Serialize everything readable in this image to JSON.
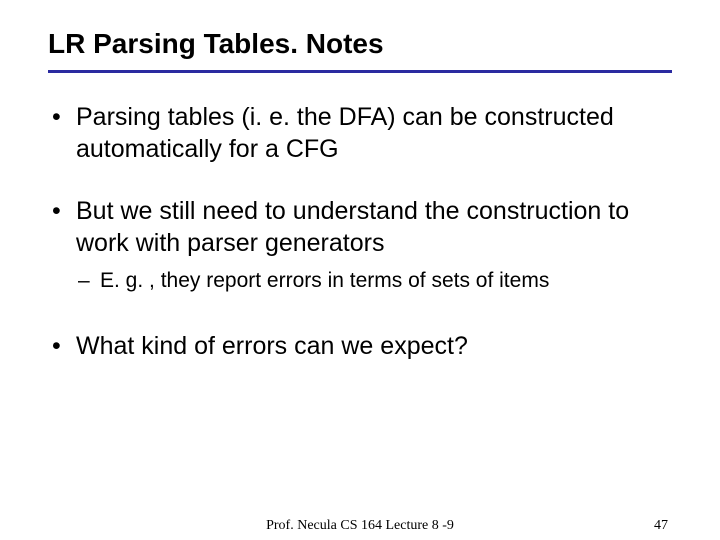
{
  "title": "LR Parsing Tables. Notes",
  "bullets": {
    "b1": "Parsing tables (i. e. the DFA) can be constructed automatically for a CFG",
    "b2": "But we still need to understand the construction to work with parser generators",
    "b2_sub": "E. g. , they report errors in terms of sets of items",
    "b3": "What kind of errors can we expect?"
  },
  "footer": {
    "center": "Prof.  Necula  CS 164  Lecture 8 -9",
    "page": "47"
  }
}
